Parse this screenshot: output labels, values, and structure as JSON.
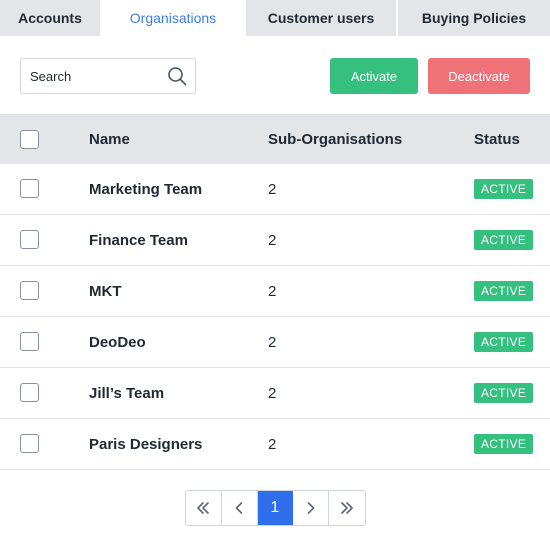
{
  "tabs": [
    {
      "label": "Accounts",
      "active": false
    },
    {
      "label": "Organisations",
      "active": true
    },
    {
      "label": "Customer users",
      "active": false
    },
    {
      "label": "Buying Policies",
      "active": false
    }
  ],
  "search": {
    "placeholder": "Search",
    "icon": "search-icon"
  },
  "actions": {
    "activate_label": "Activate",
    "deactivate_label": "Deactivate"
  },
  "table": {
    "columns": {
      "name": "Name",
      "sub_organisations": "Sub-Organisations",
      "status": "Status"
    },
    "rows": [
      {
        "name": "Marketing Team",
        "sub_organisations": "2",
        "status": "ACTIVE"
      },
      {
        "name": "Finance Team",
        "sub_organisations": "2",
        "status": "ACTIVE"
      },
      {
        "name": "MKT",
        "sub_organisations": "2",
        "status": "ACTIVE"
      },
      {
        "name": "DeoDeo",
        "sub_organisations": "2",
        "status": "ACTIVE"
      },
      {
        "name": "Jill’s Team",
        "sub_organisations": "2",
        "status": "ACTIVE"
      },
      {
        "name": "Paris Designers",
        "sub_organisations": "2",
        "status": "ACTIVE"
      }
    ]
  },
  "pagination": {
    "current_page": "1"
  },
  "colors": {
    "accent": "#2f6fec",
    "active_tab_text": "#3d7ee8",
    "activate_button": "#35c07f",
    "deactivate_button": "#f07279",
    "status_active": "#35c07f"
  }
}
